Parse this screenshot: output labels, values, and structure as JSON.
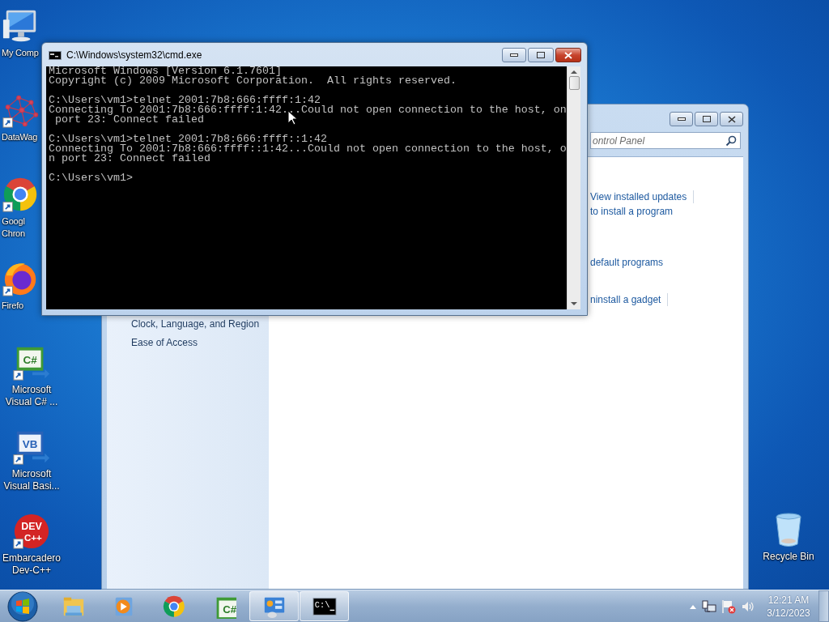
{
  "desktop_icons": [
    {
      "kind": "computer",
      "label": [
        "My Comp"
      ],
      "covered": true,
      "shortcut": false
    },
    {
      "kind": "network",
      "label": [
        "DataWag"
      ],
      "covered": true,
      "shortcut": true
    },
    {
      "kind": "chrome",
      "label": [
        "Googl",
        "Chron"
      ],
      "covered": true,
      "shortcut": true
    },
    {
      "kind": "firefox",
      "label": [
        "Firefo"
      ],
      "covered": true,
      "shortcut": true
    },
    {
      "kind": "csharp",
      "glyph": [
        "C#"
      ],
      "label": [
        "Microsoft",
        "Visual C# ..."
      ],
      "covered": false,
      "shortcut": true
    },
    {
      "kind": "vb",
      "glyph": [
        "VB"
      ],
      "label": [
        "Microsoft",
        "Visual Basi..."
      ],
      "covered": false,
      "shortcut": true
    },
    {
      "kind": "devcpp",
      "glyph": [
        "DEV",
        "C++"
      ],
      "label": [
        "Embarcadero",
        "Dev-C++"
      ],
      "covered": false,
      "shortcut": true
    }
  ],
  "recycle_bin": {
    "label": "Recycle Bin"
  },
  "control_panel": {
    "search": {
      "placeholder": "ontrol Panel"
    },
    "nav": [
      "Clock, Language, and Region",
      "Ease of Access"
    ],
    "link_groups": [
      [
        {
          "text": "View installed updates",
          "separator": true
        },
        {
          "text": "to install a program",
          "separator": false
        }
      ],
      [
        {
          "text": "default programs",
          "separator": false
        }
      ],
      [
        {
          "text": "ninstall a gadget",
          "separator": true
        }
      ]
    ]
  },
  "cmd_window": {
    "title": "C:\\Windows\\system32\\cmd.exe",
    "blocks": [
      [
        "Microsoft Windows [Version 6.1.7601]",
        "Copyright (c) 2009 Microsoft Corporation.  All rights reserved."
      ],
      [
        "C:\\Users\\vm1>telnet 2001:7b8:666:ffff:1:42",
        "Connecting To 2001:7b8:666:ffff:1:42...Could not open connection to the host, on",
        " port 23: Connect failed"
      ],
      [
        "C:\\Users\\vm1>telnet 2001:7b8:666:ffff::1:42",
        "Connecting To 2001:7b8:666:ffff::1:42...Could not open connection to the host, o",
        "n port 23: Connect failed"
      ],
      [
        "C:\\Users\\vm1>"
      ]
    ]
  },
  "taskbar": {
    "items": [
      {
        "kind": "explorer",
        "running": false
      },
      {
        "kind": "media",
        "running": false
      },
      {
        "kind": "chrome",
        "running": false
      },
      {
        "kind": "csharp",
        "glyph": "C#",
        "running": false
      },
      {
        "kind": "controlpanel",
        "running": true
      },
      {
        "kind": "cmd",
        "glyph": "C:\\",
        "running": true
      }
    ],
    "tray": [
      {
        "kind": "arrow"
      },
      {
        "kind": "network"
      },
      {
        "kind": "flag"
      },
      {
        "kind": "speaker"
      }
    ],
    "clock": {
      "time": "12:21 AM",
      "date": "3/12/2023"
    }
  }
}
